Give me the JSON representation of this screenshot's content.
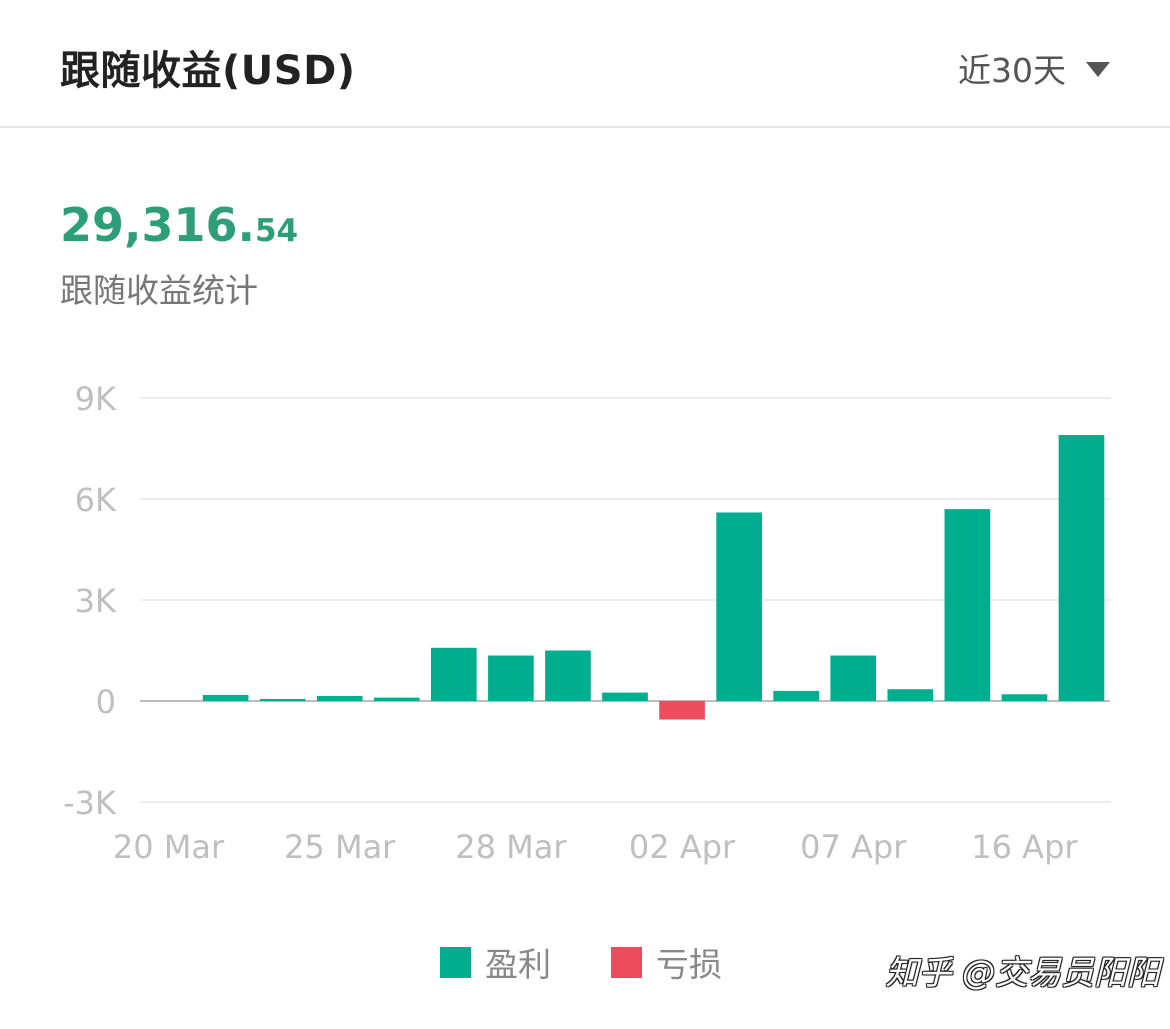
{
  "header": {
    "title": "跟随收益(USD)",
    "period": "近30天"
  },
  "summary": {
    "total_int": "29,316.",
    "total_dec": "54",
    "label": "跟随收益统计"
  },
  "colors": {
    "profit": "#00ad8e",
    "loss": "#eb4d5c",
    "total_text": "#2d9e78"
  },
  "chart_data": {
    "type": "bar",
    "title": "",
    "xlabel": "",
    "ylabel": "",
    "ylim": [
      -3000,
      9000
    ],
    "y_ticks": [
      9000,
      6000,
      3000,
      0,
      -3000
    ],
    "y_tick_labels": [
      "9K",
      "6K",
      "3K",
      "0",
      "-3K"
    ],
    "x_tick_labels": [
      "20 Mar",
      "25 Mar",
      "28 Mar",
      "02 Apr",
      "07 Apr",
      "16 Apr"
    ],
    "x_tick_label_bar_index": [
      0,
      3,
      6,
      9,
      12,
      15
    ],
    "values": [
      0,
      180,
      60,
      150,
      100,
      1580,
      1350,
      1500,
      250,
      -550,
      5600,
      300,
      1350,
      350,
      5700,
      200,
      7900
    ],
    "series": [
      {
        "name": "盈利",
        "color": "#00ad8e"
      },
      {
        "name": "亏损",
        "color": "#eb4d5c"
      }
    ],
    "grid": true,
    "legend_position": "bottom-center"
  },
  "watermark": "知乎 @交易员阳阳"
}
